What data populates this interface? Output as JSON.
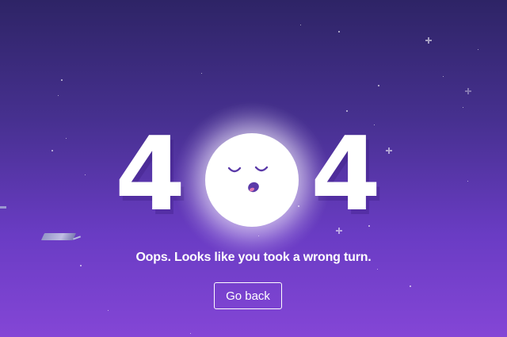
{
  "error": {
    "code_left_digit": "4",
    "code_right_digit": "4",
    "message": "Oops. Looks like you took a wrong turn."
  },
  "actions": {
    "go_back_label": "Go back"
  },
  "colors": {
    "background_top": "#2e2466",
    "background_bottom": "#8446d6",
    "foreground": "#ffffff",
    "moon_face": "#5b3aa8"
  },
  "illustration": {
    "moon_icon": "sleeping-moon-icon",
    "satellite_icon": "satellite-icon"
  }
}
